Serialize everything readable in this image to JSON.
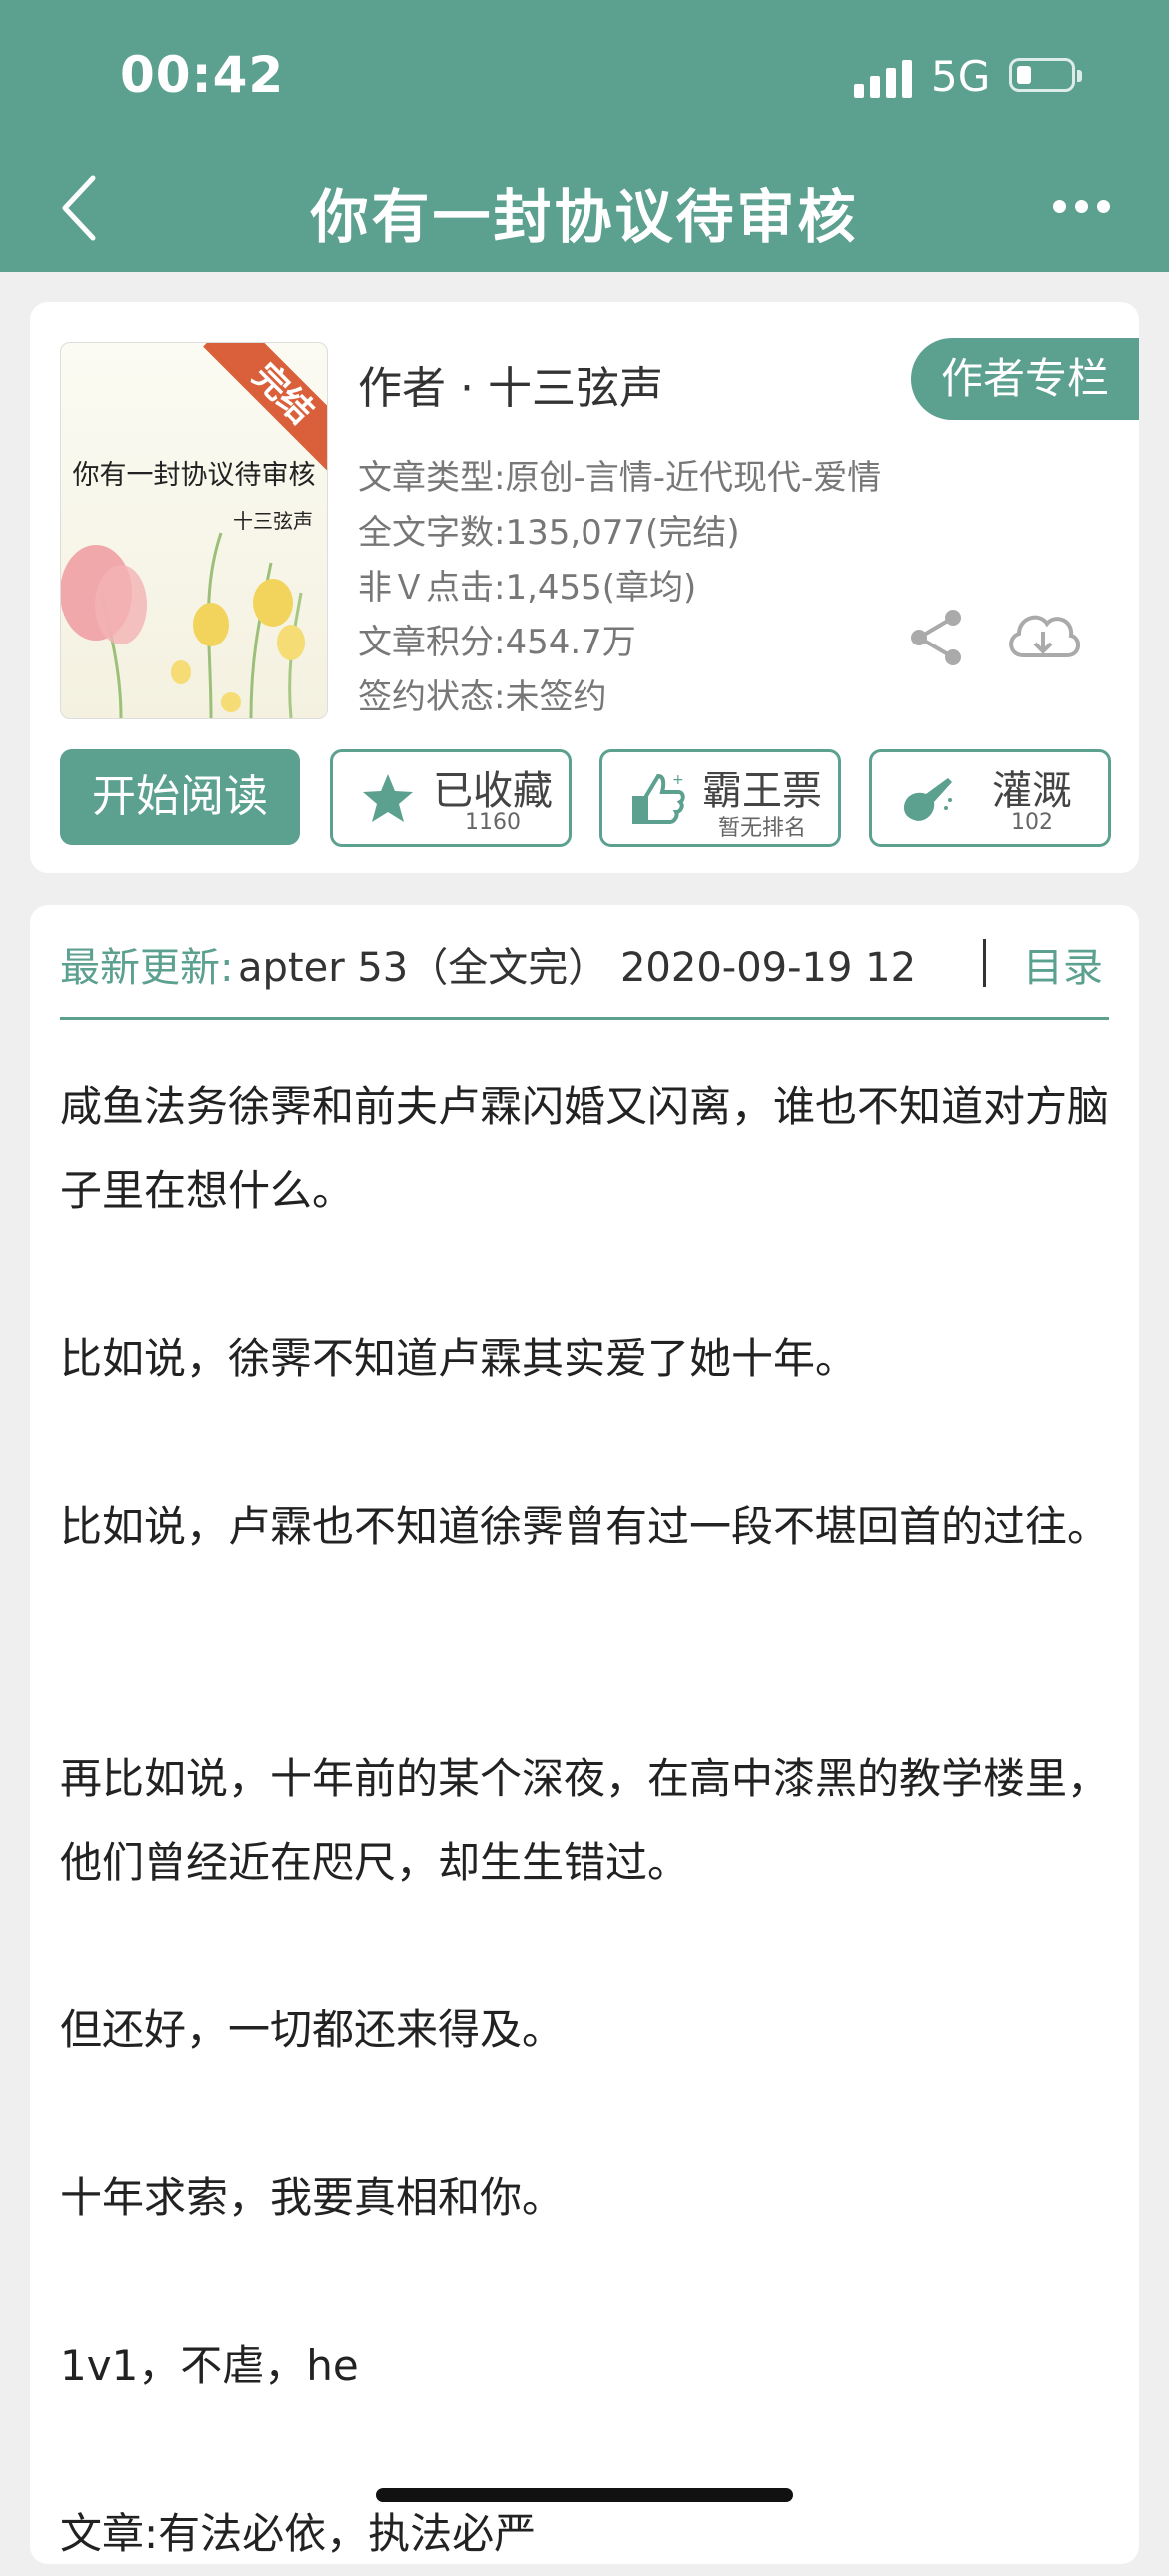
{
  "status_bar": {
    "time": "00:42",
    "network": "5G"
  },
  "header": {
    "title": "你有一封协议待审核"
  },
  "book": {
    "cover_title": "你有一封协议待审核",
    "cover_author": "十三弦声",
    "cover_badge": "完结",
    "author_line": "作者 · 十三弦声",
    "author_column_label": "作者专栏",
    "meta": [
      "文章类型:原创-言情-近代现代-爱情",
      "全文字数:135,077(完结)",
      "非Ｖ点击:1,455(章均)",
      "文章积分:454.7万",
      "签约状态:未签约"
    ]
  },
  "actions": {
    "read_label": "开始阅读",
    "collect": {
      "label": "已收藏",
      "sub": "1160"
    },
    "vote": {
      "label": "霸王票",
      "sub": "暂无排名"
    },
    "water": {
      "label": "灌溉",
      "sub": "102"
    }
  },
  "update": {
    "label": "最新更新:",
    "text": "apter 53（全文完） 2020-09-19 12",
    "toc_label": "目录"
  },
  "summary": [
    "咸鱼法务徐霁和前夫卢霖闪婚又闪离，谁也不知道对方脑子里在想什么。",
    "比如说，徐霁不知道卢霖其实爱了她十年。",
    "比如说，卢霖也不知道徐霁曾有过一段不堪回首的过往。",
    "再比如说，十年前的某个深夜，在高中漆黑的教学楼里，他们曾经近在咫尺，却生生错过。",
    "但还好，一切都还来得及。",
    "十年求索，我要真相和你。",
    "1v1，不虐，he",
    "文章:有法必依，执法必严"
  ],
  "colors": {
    "brand": "#5ca08f",
    "badge": "#d9603a"
  }
}
